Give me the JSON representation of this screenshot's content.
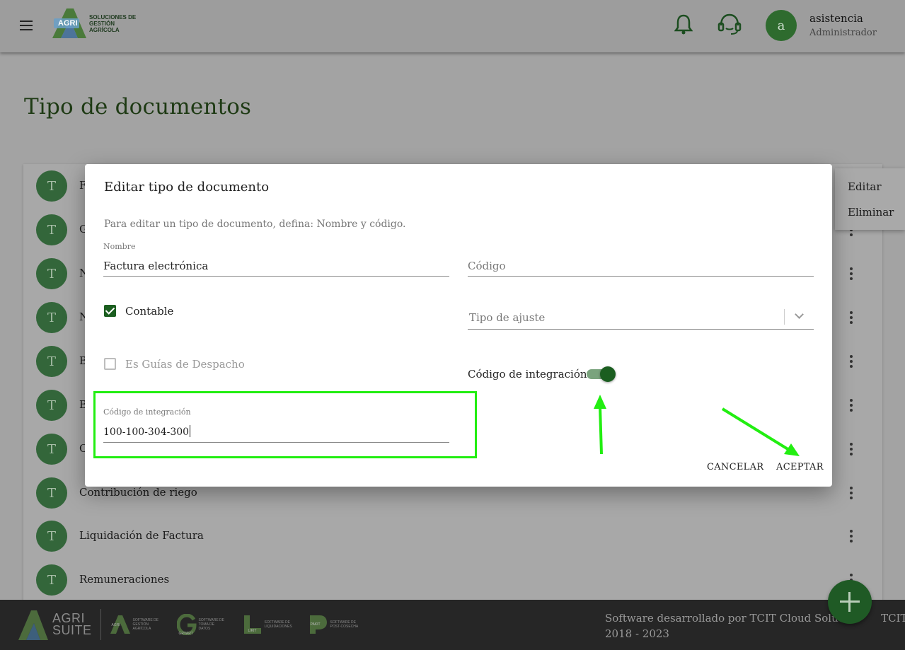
{
  "header": {
    "brand_mark": "AGRI",
    "brand_text_1": "SOLUCIONES DE",
    "brand_text_2": "GESTIÓN AGRÍCOLA",
    "user_initial": "a",
    "user_name": "asistencia",
    "user_role": "Administrador"
  },
  "page": {
    "title": "Tipo de documentos"
  },
  "list": {
    "avatar_letter": "T",
    "rows": [
      {
        "label": "F"
      },
      {
        "label": "G"
      },
      {
        "label": "N"
      },
      {
        "label": "N"
      },
      {
        "label": "B"
      },
      {
        "label": "B"
      },
      {
        "label": "C"
      },
      {
        "label": "Contribución de riego"
      },
      {
        "label": "Liquidación de Factura"
      },
      {
        "label": "Remuneraciones"
      }
    ]
  },
  "context_menu": {
    "edit": "Editar",
    "delete": "Eliminar"
  },
  "dialog": {
    "title": "Editar tipo de documento",
    "description": "Para editar un tipo de documento, defina: Nombre y código.",
    "name_label": "Nombre",
    "name_value": "Factura electrónica",
    "code_placeholder": "Código",
    "contable_label": "Contable",
    "contable_checked": true,
    "guias_label": "Es Guías de Despacho",
    "guias_checked": false,
    "tipo_ajuste_placeholder": "Tipo de ajuste",
    "integration_toggle_label": "Código de integración",
    "integration_toggle_on": true,
    "integration_code_label": "Código de integración",
    "integration_code_value": "100-100-304-300",
    "cancel": "CANCELAR",
    "accept": "ACEPTAR"
  },
  "footer": {
    "agrisuite_1": "AGRI",
    "agrisuite_2": "SUITE",
    "logos": [
      {
        "mark": "AGRI",
        "text": "SOFTWARE DE GESTIÓN AGRÍCOLA"
      },
      {
        "mark": "GRVART",
        "text": "SOFTWARE DE TOMA DE DATOS"
      },
      {
        "mark": "LIKIT",
        "text": "SOFTWARE DE LIQUIDACIONES"
      },
      {
        "mark": "PAKIT",
        "text": "SOFTWARE DE POST-COSECHA"
      }
    ],
    "credit_line1": "Software desarrollado por TCIT Cloud Solution",
    "credit_line1_tail": "TCIT",
    "credit_line2": "2018 - 2023"
  },
  "colors": {
    "brand_green": "#1b5e20",
    "highlight": "#22ee11",
    "overlay_gray": "#a3a3a3"
  }
}
